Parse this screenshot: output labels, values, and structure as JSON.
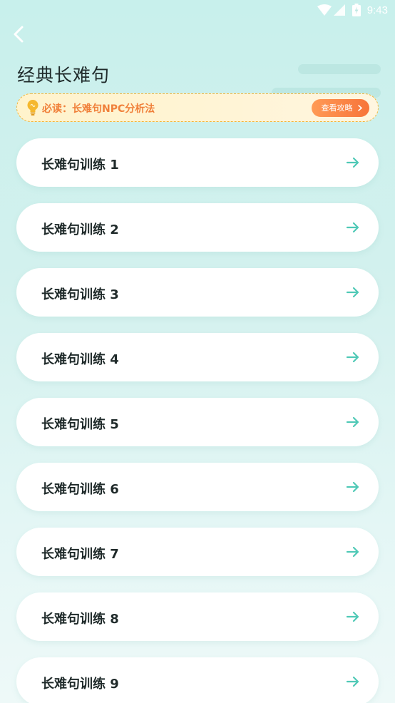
{
  "status_bar": {
    "time": "9:43",
    "icons": [
      "wifi-icon",
      "cell-signal-icon",
      "battery-icon"
    ]
  },
  "header": {
    "back_icon": "back-chevron-icon",
    "title": "经典长难句"
  },
  "banner": {
    "icon": "lightbulb-icon",
    "text": "必读：长难句NPC分析法",
    "button_label": "查看攻略",
    "button_icon": "chevron-right-icon"
  },
  "list": {
    "items": [
      {
        "label": "长难句训练 1"
      },
      {
        "label": "长难句训练 2"
      },
      {
        "label": "长难句训练 3"
      },
      {
        "label": "长难句训练 4"
      },
      {
        "label": "长难句训练 5"
      },
      {
        "label": "长难句训练 6"
      },
      {
        "label": "长难句训练 7"
      },
      {
        "label": "长难句训练 8"
      },
      {
        "label": "长难句训练 9"
      }
    ],
    "item_icon": "arrow-right-icon"
  },
  "colors": {
    "accent": "#4fc9b6",
    "banner_text": "#f0803a",
    "button": "#f7743a",
    "bulb": "#f5b82e"
  }
}
